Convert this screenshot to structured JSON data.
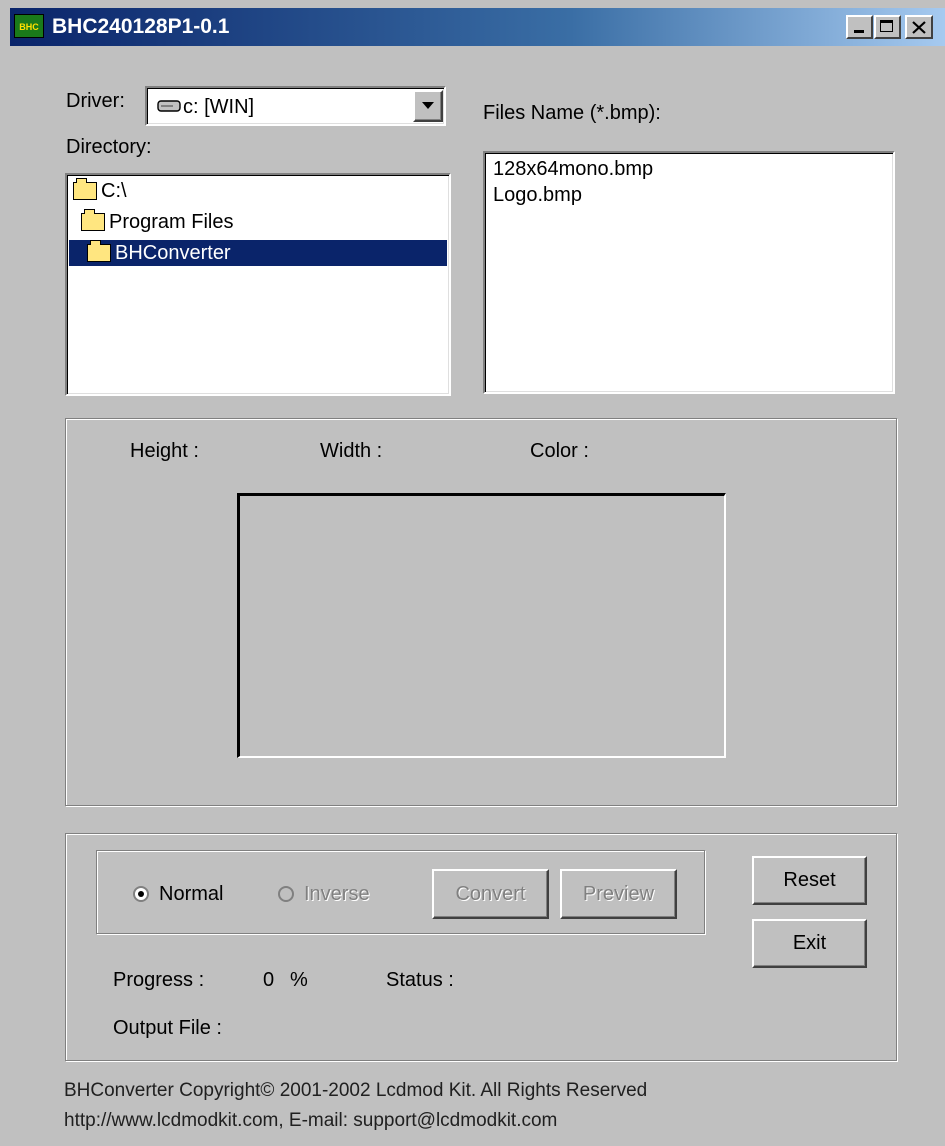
{
  "window": {
    "title": "BHC240128P1-0.1",
    "icon_text": "BHC"
  },
  "driver": {
    "label": "Driver:",
    "selected": "c: [WIN]"
  },
  "directory": {
    "label": "Directory:",
    "items": [
      {
        "name": "C:\\"
      },
      {
        "name": "Program Files"
      },
      {
        "name": "BHConverter"
      }
    ]
  },
  "files": {
    "label": "Files Name (*.bmp):",
    "items": [
      "128x64mono.bmp",
      "Logo.bmp"
    ]
  },
  "info": {
    "height_label": "Height :",
    "width_label": "Width :",
    "color_label": "Color :"
  },
  "options": {
    "normal_label": "Normal",
    "inverse_label": "Inverse",
    "convert_label": "Convert",
    "preview_label": "Preview",
    "reset_label": "Reset",
    "exit_label": "Exit"
  },
  "progress": {
    "label": "Progress :",
    "value": "0",
    "unit": "%",
    "status_label": "Status :",
    "output_label": "Output File :"
  },
  "footer": {
    "line1": "BHConverter Copyright©  2001-2002 Lcdmod Kit. All Rights Reserved",
    "line2": "http://www.lcdmodkit.com, E-mail: support@lcdmodkit.com"
  },
  "colors": {
    "selection": "#0a246a",
    "face": "#c0c0c0"
  }
}
